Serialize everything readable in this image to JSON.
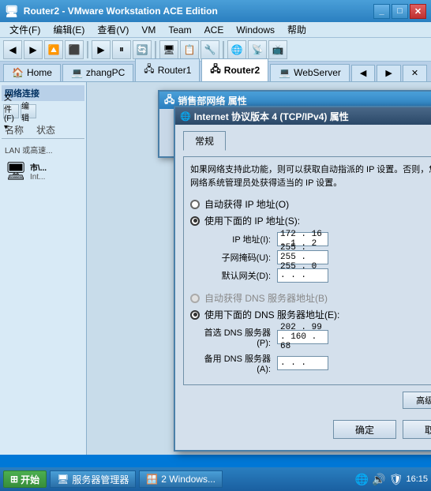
{
  "window": {
    "title": "Router2 - VMware Workstation ACE Edition",
    "icon": "🖥"
  },
  "menu": {
    "items": [
      "文件(F)",
      "编辑(E)",
      "查看(V)",
      "VM",
      "Team",
      "ACE",
      "Windows",
      "帮助"
    ]
  },
  "tabs": [
    {
      "label": "Home",
      "icon": "🏠",
      "active": false
    },
    {
      "label": "zhangPC",
      "icon": "💻",
      "active": false
    },
    {
      "label": "Router1",
      "icon": "🖧",
      "active": false
    },
    {
      "label": "Router2",
      "icon": "🖧",
      "active": true
    },
    {
      "label": "WebServer",
      "icon": "💻",
      "active": false
    }
  ],
  "sidebar": {
    "header": "网络连接",
    "labels": {
      "name": "名称",
      "status": "状态",
      "type": "LAN 或高速..."
    },
    "items": [
      {
        "name": "市\\...",
        "subtext": "Int..."
      }
    ]
  },
  "dialog_sales": {
    "title": "销售部网络 属性"
  },
  "dialog_tcp": {
    "title": "Internet 协议版本 4 (TCP/IPv4) 属性",
    "help_label": "?",
    "close_label": "×",
    "tab_label": "常规",
    "info_text": "如果网络支持此功能，则可以获取自动指派的 IP 设置。否则，您需要从网络系统管理员处获得适当的 IP 设置。",
    "radio_auto_ip": "自动获得 IP 地址(O)",
    "radio_manual_ip": "使用下面的 IP 地址(S):",
    "label_ip": "IP 地址(I):",
    "label_subnet": "子网掩码(U):",
    "label_gateway": "默认网关(D):",
    "ip_value": "172 . 16 . 1 . 2",
    "subnet_value": "255 . 255 . 255 . 0",
    "gateway_value": ". . .",
    "radio_auto_dns": "自动获得 DNS 服务器地址(B)",
    "radio_manual_dns": "使用下面的 DNS 服务器地址(E):",
    "label_preferred_dns": "首选 DNS 服务器(P):",
    "label_alternate_dns": "备用 DNS 服务器(A):",
    "preferred_dns_value": "202 . 99 . 160 . 68",
    "alternate_dns_value": ". . .",
    "advanced_btn": "高级(V)...",
    "ok_btn": "确定",
    "cancel_btn": "取消"
  },
  "taskbar": {
    "start_label": "开始",
    "items": [
      "服务器管理器",
      "2 Windows..."
    ],
    "time": "16:15"
  }
}
